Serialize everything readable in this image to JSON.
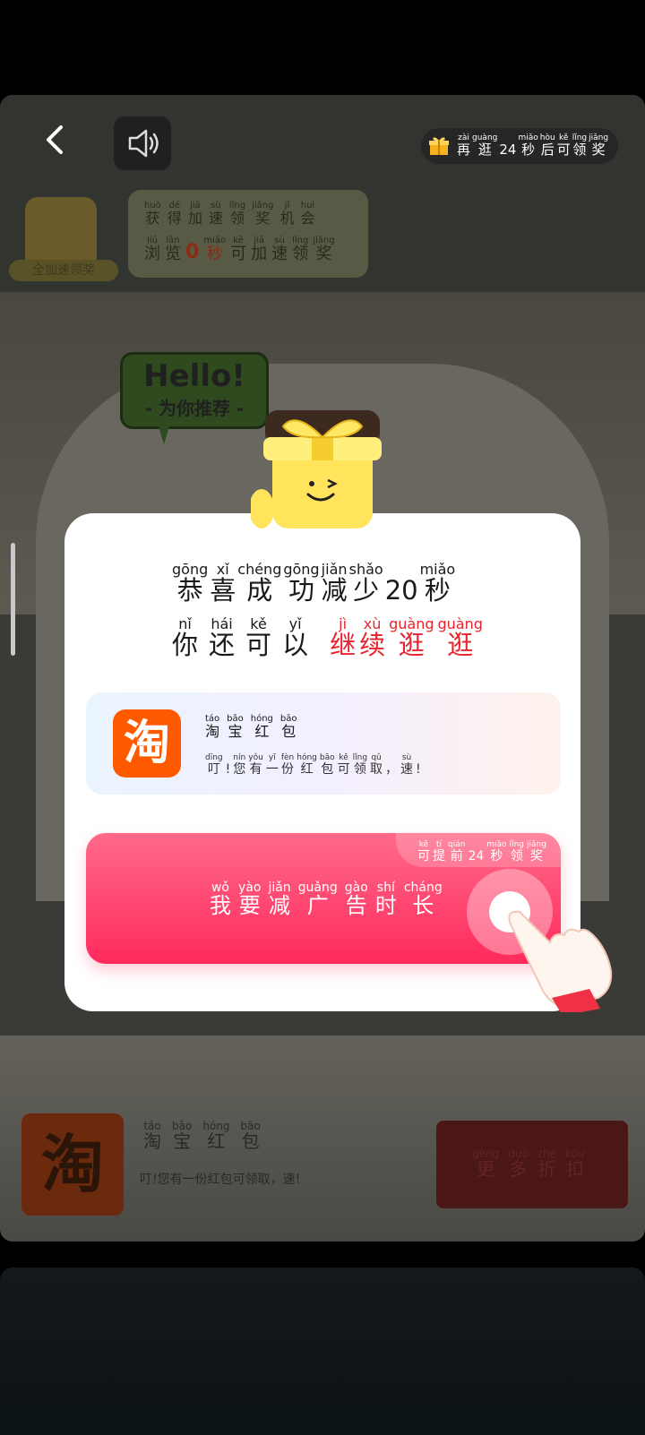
{
  "top_bar": {
    "reward_text": [
      {
        "py": "zài",
        "hz": "再"
      },
      {
        "py": "guàng",
        "hz": "逛"
      },
      {
        "py": "",
        "hz": "24"
      },
      {
        "py": "miǎo",
        "hz": "秒"
      },
      {
        "py": "hòu",
        "hz": "后"
      },
      {
        "py": "kě",
        "hz": "可"
      },
      {
        "py": "lǐng",
        "hz": "领"
      },
      {
        "py": "jiǎng",
        "hz": "奖"
      }
    ]
  },
  "speed_bubble": {
    "line1": [
      {
        "py": "huò",
        "hz": "获"
      },
      {
        "py": "dé",
        "hz": "得"
      },
      {
        "py": "jiā",
        "hz": "加"
      },
      {
        "py": "sù",
        "hz": "速"
      },
      {
        "py": "lǐng",
        "hz": "领"
      },
      {
        "py": "jiǎng",
        "hz": "奖"
      },
      {
        "py": "jī",
        "hz": "机"
      },
      {
        "py": "huì",
        "hz": "会"
      }
    ],
    "line2": [
      {
        "py": "liú",
        "hz": "浏"
      },
      {
        "py": "lǎn",
        "hz": "览"
      },
      {
        "py": "",
        "hz": "0"
      },
      {
        "py": "miǎo",
        "hz": "秒"
      },
      {
        "py": "kě",
        "hz": "可"
      },
      {
        "py": "jiā",
        "hz": "加"
      },
      {
        "py": "sù",
        "hz": "速"
      },
      {
        "py": "lǐng",
        "hz": "领"
      },
      {
        "py": "jiǎng",
        "hz": "奖"
      }
    ]
  },
  "mascot_label": "全加速领奖",
  "hello": {
    "big": "Hello!",
    "small": "- 为你推荐 -"
  },
  "modal": {
    "title": [
      {
        "py": "gōng",
        "hz": "恭"
      },
      {
        "py": "xǐ",
        "hz": "喜"
      },
      {
        "py": "chéng",
        "hz": "成"
      },
      {
        "py": "gōng",
        "hz": "功"
      },
      {
        "py": "jiǎn",
        "hz": "减"
      },
      {
        "py": "shǎo",
        "hz": "少"
      },
      {
        "py": "",
        "hz": "20"
      },
      {
        "py": "miǎo",
        "hz": "秒"
      }
    ],
    "subtitle_black": [
      {
        "py": "nǐ",
        "hz": "你"
      },
      {
        "py": "hái",
        "hz": "还"
      },
      {
        "py": "kě",
        "hz": "可"
      },
      {
        "py": "yǐ",
        "hz": "以"
      }
    ],
    "subtitle_red": [
      {
        "py": "jì",
        "hz": "继"
      },
      {
        "py": "xù",
        "hz": "续"
      },
      {
        "py": "guàng",
        "hz": "逛"
      },
      {
        "py": "guàng",
        "hz": "逛"
      }
    ],
    "taobao": {
      "logo": "淘",
      "title": [
        {
          "py": "táo",
          "hz": "淘"
        },
        {
          "py": "bǎo",
          "hz": "宝"
        },
        {
          "py": "hóng",
          "hz": "红"
        },
        {
          "py": "bāo",
          "hz": "包"
        }
      ],
      "desc": [
        {
          "py": "dīng",
          "hz": "叮"
        },
        {
          "py": "",
          "hz": "!"
        },
        {
          "py": "nín",
          "hz": "您"
        },
        {
          "py": "yǒu",
          "hz": "有"
        },
        {
          "py": "yī",
          "hz": "一"
        },
        {
          "py": "fèn",
          "hz": "份"
        },
        {
          "py": "hóng",
          "hz": "红"
        },
        {
          "py": "bāo",
          "hz": "包"
        },
        {
          "py": "kě",
          "hz": "可"
        },
        {
          "py": "lǐng",
          "hz": "领"
        },
        {
          "py": "qǔ",
          "hz": "取"
        },
        {
          "py": "",
          "hz": "，"
        },
        {
          "py": "sù",
          "hz": "速"
        },
        {
          "py": "",
          "hz": "!"
        }
      ]
    },
    "cta": {
      "label": [
        {
          "py": "wǒ",
          "hz": "我"
        },
        {
          "py": "yào",
          "hz": "要"
        },
        {
          "py": "jiǎn",
          "hz": "减"
        },
        {
          "py": "guǎng",
          "hz": "广"
        },
        {
          "py": "gào",
          "hz": "告"
        },
        {
          "py": "shí",
          "hz": "时"
        },
        {
          "py": "cháng",
          "hz": "长"
        }
      ],
      "tag": [
        {
          "py": "kě",
          "hz": "可"
        },
        {
          "py": "tí",
          "hz": "提"
        },
        {
          "py": "qián",
          "hz": "前"
        },
        {
          "py": "",
          "hz": "24"
        },
        {
          "py": "miǎo",
          "hz": "秒"
        },
        {
          "py": "lǐng",
          "hz": "领"
        },
        {
          "py": "jiǎng",
          "hz": "奖"
        }
      ]
    }
  },
  "background_ad": {
    "logo": "淘",
    "title": [
      {
        "py": "táo",
        "hz": "淘"
      },
      {
        "py": "bǎo",
        "hz": "宝"
      },
      {
        "py": "hóng",
        "hz": "红"
      },
      {
        "py": "bāo",
        "hz": "包"
      }
    ],
    "desc": "叮!您有一份红包可领取，速!",
    "button": [
      {
        "py": "gèng",
        "hz": "更"
      },
      {
        "py": "duō",
        "hz": "多"
      },
      {
        "py": "zhé",
        "hz": "折"
      },
      {
        "py": "kòu",
        "hz": "扣"
      }
    ]
  },
  "colors": {
    "accent_red": "#e8232d",
    "cta": "#ff3a66",
    "taobao": "#ff5a00"
  }
}
